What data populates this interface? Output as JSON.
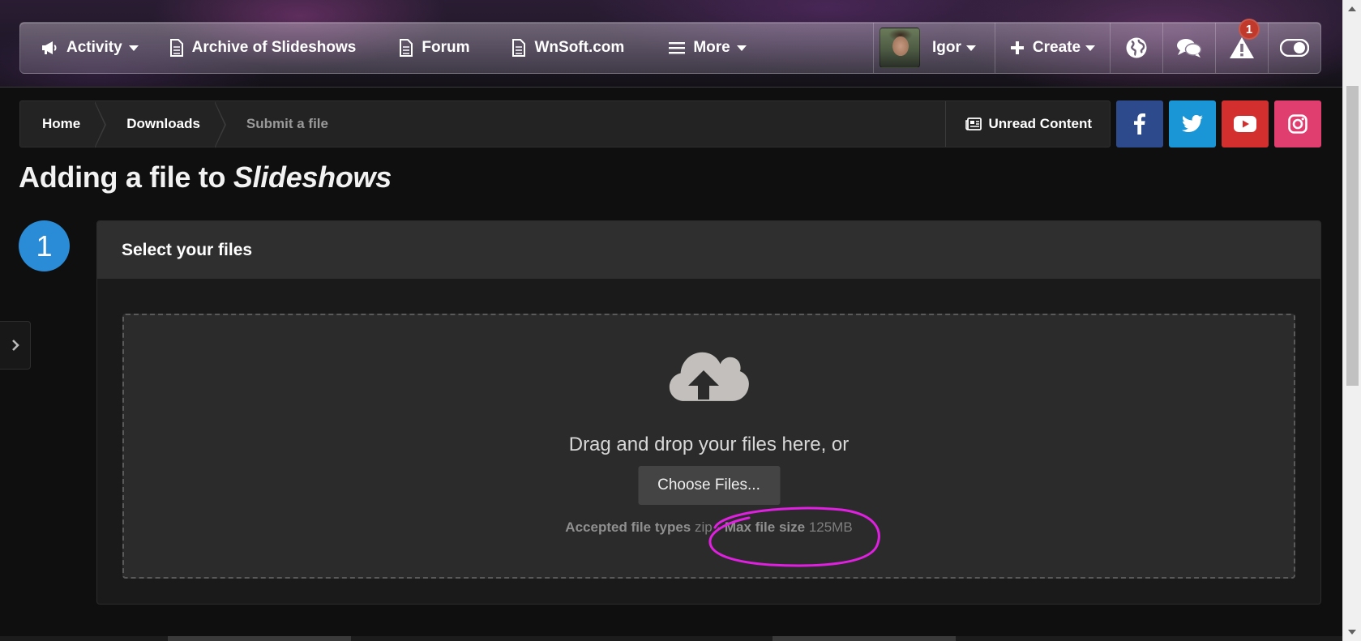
{
  "nav": {
    "items": [
      {
        "label": "Activity",
        "icon": "megaphone-icon",
        "has_caret": true
      },
      {
        "label": "Archive of Slideshows",
        "icon": "document-icon",
        "has_caret": false
      },
      {
        "label": "Forum",
        "icon": "document-icon",
        "has_caret": false
      },
      {
        "label": "WnSoft.com",
        "icon": "document-icon",
        "has_caret": false
      },
      {
        "label": "More",
        "icon": "menu-icon",
        "has_caret": true
      }
    ],
    "user_name": "Igor",
    "create_label": "Create",
    "notification_count": "1"
  },
  "breadcrumb": {
    "home": "Home",
    "downloads": "Downloads",
    "current": "Submit a file",
    "unread_label": "Unread Content"
  },
  "social": {
    "facebook_color": "#2d4a8c",
    "twitter_color": "#1a95d6",
    "youtube_color": "#d32f2f",
    "instagram_color": "#e03e6e"
  },
  "page": {
    "title_prefix": "Adding a file to ",
    "title_emph": "Slideshows"
  },
  "step": {
    "number": "1",
    "heading": "Select your files"
  },
  "upload": {
    "drop_text": "Drag and drop your files here, or",
    "choose_button": "Choose Files...",
    "accepted_label": "Accepted file types",
    "accepted_value": "zip",
    "separator": "·",
    "max_label": "Max file size",
    "max_value": "125MB"
  },
  "colors": {
    "accent": "#2a8bd6",
    "annotation": "#e020e0"
  }
}
